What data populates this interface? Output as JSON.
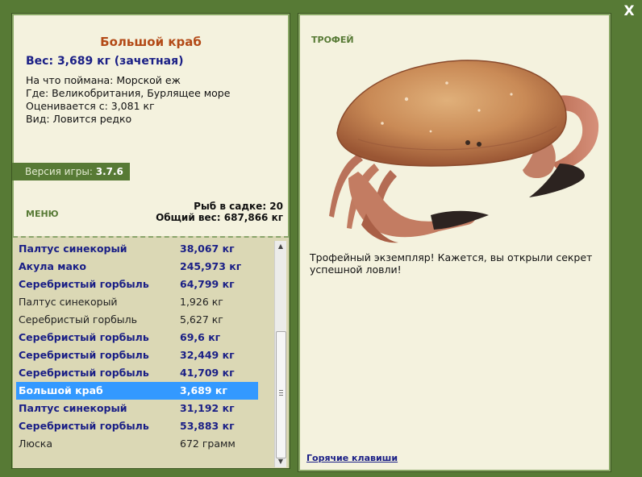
{
  "window": {
    "close_label": "X"
  },
  "fish": {
    "title": "Большой краб",
    "weight_line": "Вес: 3,689 кг (зачетная)",
    "bait_line": "На что поймана: Морской еж",
    "location_line": "Где: Великобритания, Бурлящее море",
    "value_line": "Оценивается с: 3,081 кг",
    "type_line": "Вид: Ловится редко"
  },
  "version": {
    "label": "Версия игры: ",
    "value": "3.7.6"
  },
  "menu": {
    "label": "МЕНЮ"
  },
  "stats": {
    "fish_count": "Рыб в садке: 20",
    "total_weight": "Общий вес: 687,866 кг"
  },
  "catch_list": [
    {
      "name": "Палтус синекорый",
      "weight": "38,067 кг",
      "bold": true,
      "selected": false
    },
    {
      "name": "Акула мако",
      "weight": "245,973 кг",
      "bold": true,
      "selected": false
    },
    {
      "name": "Серебристый горбыль",
      "weight": "64,799 кг",
      "bold": true,
      "selected": false
    },
    {
      "name": "Палтус синекорый",
      "weight": "1,926 кг",
      "bold": false,
      "selected": false
    },
    {
      "name": "Серебристый горбыль",
      "weight": "5,627 кг",
      "bold": false,
      "selected": false
    },
    {
      "name": "Серебристый горбыль",
      "weight": "69,6 кг",
      "bold": true,
      "selected": false
    },
    {
      "name": "Серебристый горбыль",
      "weight": "32,449 кг",
      "bold": true,
      "selected": false
    },
    {
      "name": "Серебристый горбыль",
      "weight": "41,709 кг",
      "bold": true,
      "selected": false
    },
    {
      "name": "Большой краб",
      "weight": "3,689 кг",
      "bold": true,
      "selected": true
    },
    {
      "name": "Палтус синекорый",
      "weight": "31,192 кг",
      "bold": true,
      "selected": false
    },
    {
      "name": "Серебристый горбыль",
      "weight": "53,883 кг",
      "bold": true,
      "selected": false
    },
    {
      "name": "Люска",
      "weight": "672 грамм",
      "bold": false,
      "selected": false
    }
  ],
  "trophy": {
    "label": "ТРОФЕЙ",
    "text": "Трофейный экземпляр! Кажется, вы открыли секрет успешной ловли!"
  },
  "hotkeys": {
    "label": "Горячие клавиши"
  },
  "colors": {
    "background": "#577a35",
    "panel": "#f4f2de",
    "list_bg": "#dbd8b5",
    "title": "#b34a17",
    "bold_text": "#1a1f86",
    "selection": "#3399ff"
  }
}
